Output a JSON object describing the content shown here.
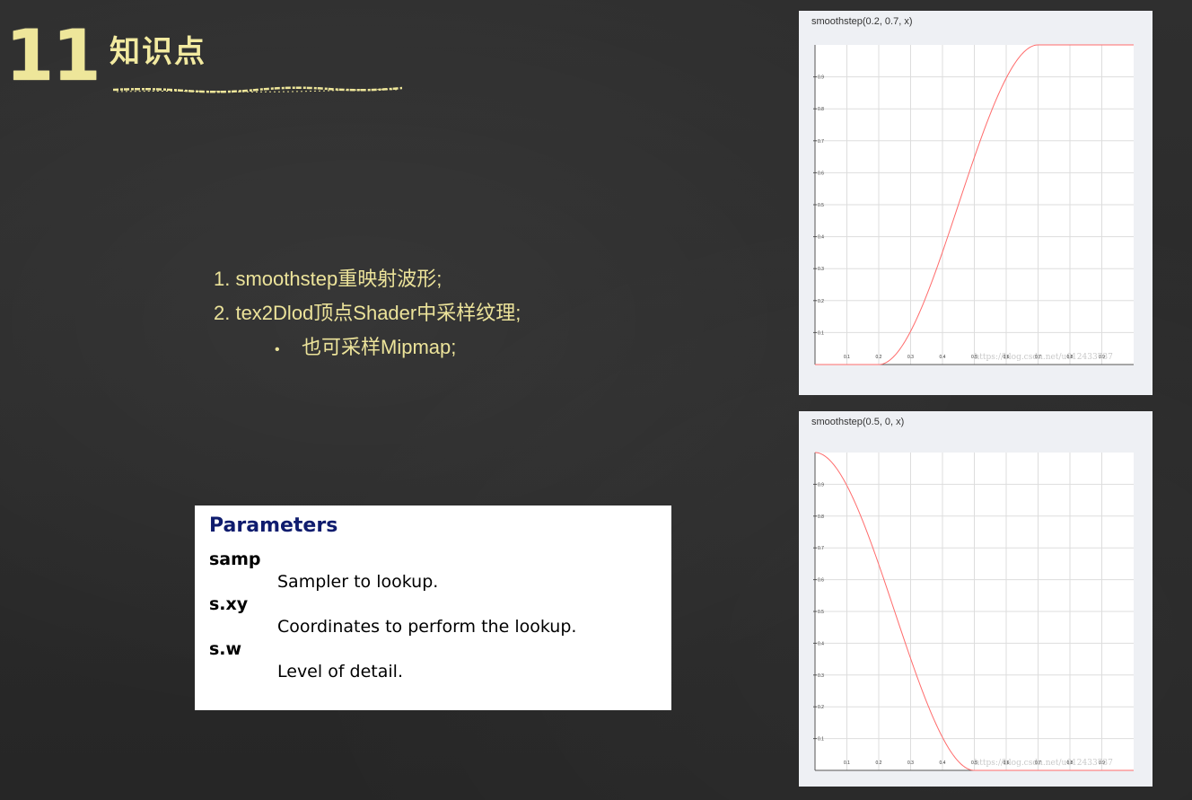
{
  "header": {
    "number": "11",
    "title": "知识点"
  },
  "bullets": {
    "item1": "1. smoothstep重映射波形;",
    "item2": "2. tex2Dlod顶点Shader中采样纹理;",
    "sub1_marker": "•",
    "sub1": "也可采样Mipmap;"
  },
  "params": {
    "heading": "Parameters",
    "items": [
      {
        "name": "samp",
        "desc": "Sampler to lookup."
      },
      {
        "name": "s.xy",
        "desc": "Coordinates to perform the lookup."
      },
      {
        "name": "s.w",
        "desc": "Level of detail."
      }
    ]
  },
  "colors": {
    "chalk_yellow": "#eee69a",
    "board": "#2b2b2b",
    "curve": "#ff6b6b",
    "param_heading": "#0f1c6e"
  },
  "chart_data": [
    {
      "type": "line",
      "title": "smoothstep(0.2, 0.7, x)",
      "edge0": 0.2,
      "edge1": 0.7,
      "x": [
        0,
        0.1,
        0.2,
        0.3,
        0.4,
        0.5,
        0.6,
        0.7,
        0.8,
        0.9,
        1.0
      ],
      "y": [
        0,
        0,
        0,
        0.104,
        0.352,
        0.648,
        0.896,
        1,
        1,
        1,
        1
      ],
      "xticks": [
        "0.1",
        "0.2",
        "0.3",
        "0.4",
        "0.5",
        "0.6",
        "0.7",
        "0.8",
        "0.9"
      ],
      "yticks": [
        "0.1",
        "0.2",
        "0.3",
        "0.4",
        "0.5",
        "0.6",
        "0.7",
        "0.8",
        "0.9"
      ],
      "xlim": [
        0,
        1
      ],
      "ylim": [
        0,
        1
      ],
      "grid": true,
      "watermark": "https://blog.csdn.net/u012433737"
    },
    {
      "type": "line",
      "title": "smoothstep(0.5, 0, x)",
      "edge0": 0.5,
      "edge1": 0,
      "x": [
        0,
        0.1,
        0.2,
        0.3,
        0.4,
        0.5,
        0.6,
        0.7,
        0.8,
        0.9,
        1.0
      ],
      "y": [
        1,
        0.896,
        0.648,
        0.352,
        0.104,
        0,
        0,
        0,
        0,
        0,
        0
      ],
      "xticks": [
        "0.1",
        "0.2",
        "0.3",
        "0.4",
        "0.5",
        "0.6",
        "0.7",
        "0.8",
        "0.9"
      ],
      "yticks": [
        "0.1",
        "0.2",
        "0.3",
        "0.4",
        "0.5",
        "0.6",
        "0.7",
        "0.8",
        "0.9"
      ],
      "xlim": [
        0,
        1
      ],
      "ylim": [
        0,
        1
      ],
      "grid": true,
      "watermark": "https://blog.csdn.net/u012433737"
    }
  ]
}
